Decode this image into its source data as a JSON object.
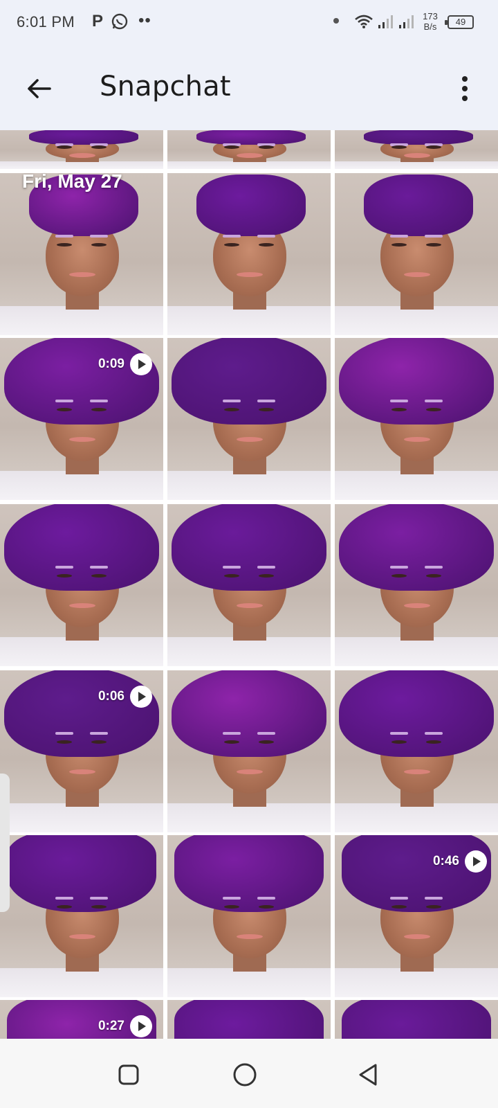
{
  "status_bar": {
    "time": "6:01 PM",
    "notif_p": "P",
    "notif_dots": "••",
    "speed_value": "173",
    "speed_unit": "B/s",
    "battery": "49"
  },
  "app_bar": {
    "title": "Snapchat"
  },
  "grid": {
    "date_header": "Fri, May 27",
    "accent_purple": "#7b1fa2",
    "videos": [
      {
        "duration": "0:09"
      },
      {
        "duration": "0:06"
      },
      {
        "duration": "0:46"
      },
      {
        "duration": "0:27"
      }
    ]
  },
  "nav_bar": {
    "buttons": [
      "recents-square-icon",
      "home-circle-icon",
      "back-triangle-icon"
    ]
  }
}
